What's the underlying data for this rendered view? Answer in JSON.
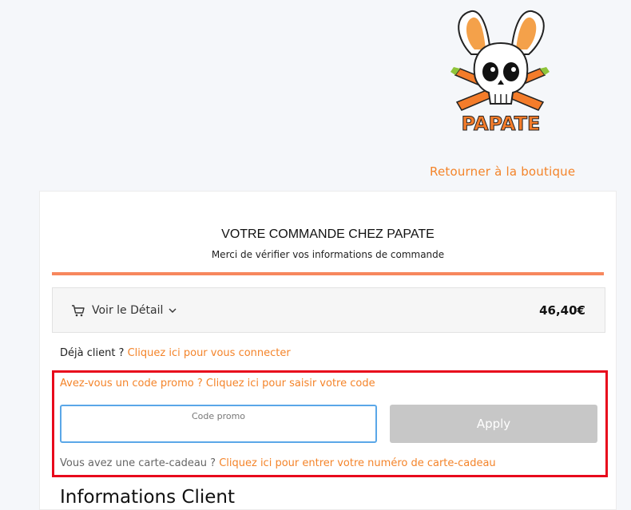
{
  "header": {
    "brand_name": "PAPATE",
    "back_link": "Retourner à la boutique"
  },
  "order": {
    "title": "VOTRE COMMANDE CHEZ PAPATE",
    "subtitle": "Merci de vérifier vos informations de commande",
    "detail_label": "Voir le Détail",
    "total": "46,40€"
  },
  "login": {
    "prefix": "Déjà client ?",
    "link": "Cliquez ici pour vous connecter"
  },
  "promo": {
    "question": "Avez-vous un code promo ? Cliquez ici pour saisir votre code",
    "input_label": "Code promo",
    "input_value": "",
    "apply_label": "Apply"
  },
  "gift_card": {
    "prefix": "Vous avez une carte-cadeau ?",
    "link": "Cliquez ici pour entrer votre numéro de carte-cadeau"
  },
  "client_info": {
    "heading": "Informations Client"
  },
  "colors": {
    "accent": "#f4842a",
    "divider": "#f7875d",
    "highlight": "#e8081c",
    "input_border": "#5aa7e8",
    "apply_disabled": "#c7c7c7"
  },
  "icons": [
    "bunny-skull-logo",
    "cart-icon",
    "chevron-down-icon"
  ]
}
